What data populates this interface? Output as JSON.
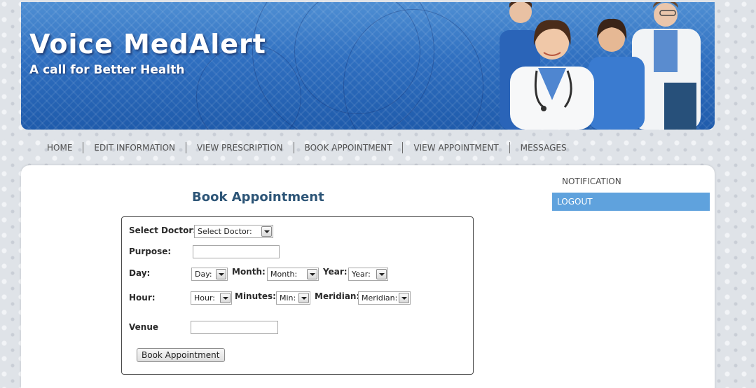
{
  "header": {
    "title": "Voice MedAlert",
    "tagline": "A call for Better Health"
  },
  "topnav": {
    "items": [
      "HOME",
      "EDIT INFORMATION",
      "VIEW PRESCRIPTION",
      "BOOK APPOINTMENT",
      "VIEW APPOINTMENT",
      "MESSAGES"
    ]
  },
  "sidebar": {
    "items": [
      {
        "label": "NOTIFICATION",
        "active": false
      },
      {
        "label": "LOGOUT",
        "active": true
      }
    ]
  },
  "main": {
    "heading": "Book Appointment",
    "form": {
      "doctor_label": "Select Doctor:",
      "doctor_selected": "Select Doctor:",
      "purpose_label": "Purpose:",
      "purpose_value": "",
      "day_label": "Day:",
      "day_selected": "Day:",
      "month_label": "Month:",
      "month_selected": "Month:",
      "year_label": "Year:",
      "year_selected": "Year:",
      "hour_label": "Hour:",
      "hour_selected": "Hour:",
      "minutes_label": "Minutes:",
      "minutes_selected": "Min:",
      "meridian_label": "Meridian:",
      "meridian_selected": "Meridian:",
      "venue_label": "Venue",
      "venue_value": "",
      "submit_label": "Book Appointment"
    }
  },
  "colors": {
    "banner": "#2f6fc0",
    "active_menu": "#5fa2dd",
    "heading": "#2d5577"
  }
}
